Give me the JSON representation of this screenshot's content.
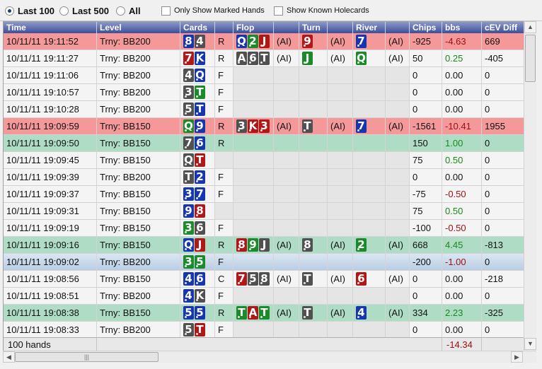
{
  "toolbar": {
    "last100_label": "Last 100",
    "last500_label": "Last 500",
    "all_label": "All",
    "selected_range": "Last 100",
    "only_marked_label": "Only Show Marked Hands",
    "show_known_label": "Show Known Holecards"
  },
  "columns": [
    "Time",
    "Level",
    "Cards",
    "",
    "Flop",
    "",
    "Turn",
    "",
    "River",
    "",
    "Chips",
    "bbs",
    "cEV Diff"
  ],
  "rows": [
    {
      "time": "10/11/11 19:11:52",
      "level": "Trny: BB200",
      "hole": [
        [
          "8",
          "d"
        ],
        [
          "4",
          "s"
        ]
      ],
      "action": "R",
      "flop": [
        [
          "Q",
          "d"
        ],
        [
          "2",
          "c"
        ],
        [
          "J",
          "h"
        ]
      ],
      "flop_ai": "(AI)",
      "turn": [
        [
          "9",
          "h"
        ]
      ],
      "turn_ai": "(AI)",
      "river": [
        [
          "7",
          "d"
        ]
      ],
      "river_ai": "(AI)",
      "chips": "-925",
      "bbs": "-4.63",
      "cev": "669",
      "highlight": "red",
      "sel": false
    },
    {
      "time": "10/11/11 19:11:27",
      "level": "Trny: BB200",
      "hole": [
        [
          "7",
          "h"
        ],
        [
          "K",
          "d"
        ]
      ],
      "action": "R",
      "flop": [
        [
          "A",
          "s"
        ],
        [
          "6",
          "s"
        ],
        [
          "T",
          "s"
        ]
      ],
      "flop_ai": "(AI)",
      "turn": [
        [
          "J",
          "c"
        ]
      ],
      "turn_ai": "(AI)",
      "river": [
        [
          "Q",
          "c"
        ]
      ],
      "river_ai": "(AI)",
      "chips": "50",
      "bbs": "0.25",
      "cev": "-405",
      "highlight": "",
      "sel": false
    },
    {
      "time": "10/11/11 19:11:06",
      "level": "Trny: BB200",
      "hole": [
        [
          "4",
          "s"
        ],
        [
          "Q",
          "d"
        ]
      ],
      "action": "F",
      "flop": [],
      "flop_ai": "",
      "turn": [],
      "turn_ai": "",
      "river": [],
      "river_ai": "",
      "chips": "0",
      "bbs": "0.00",
      "cev": "0",
      "highlight": "",
      "sel": false
    },
    {
      "time": "10/11/11 19:10:57",
      "level": "Trny: BB200",
      "hole": [
        [
          "3",
          "s"
        ],
        [
          "T",
          "c"
        ]
      ],
      "action": "F",
      "flop": [],
      "flop_ai": "",
      "turn": [],
      "turn_ai": "",
      "river": [],
      "river_ai": "",
      "chips": "0",
      "bbs": "0.00",
      "cev": "0",
      "highlight": "",
      "sel": false
    },
    {
      "time": "10/11/11 19:10:28",
      "level": "Trny: BB200",
      "hole": [
        [
          "5",
          "s"
        ],
        [
          "T",
          "d"
        ]
      ],
      "action": "F",
      "flop": [],
      "flop_ai": "",
      "turn": [],
      "turn_ai": "",
      "river": [],
      "river_ai": "",
      "chips": "0",
      "bbs": "0.00",
      "cev": "0",
      "highlight": "",
      "sel": false
    },
    {
      "time": "10/11/11 19:09:59",
      "level": "Trny: BB150",
      "hole": [
        [
          "Q",
          "c"
        ],
        [
          "9",
          "d"
        ]
      ],
      "action": "R",
      "flop": [
        [
          "3",
          "s"
        ],
        [
          "K",
          "h"
        ],
        [
          "3",
          "h"
        ]
      ],
      "flop_ai": "(AI)",
      "turn": [
        [
          "T",
          "s"
        ]
      ],
      "turn_ai": "(AI)",
      "river": [
        [
          "7",
          "d"
        ]
      ],
      "river_ai": "(AI)",
      "chips": "-1561",
      "bbs": "-10.41",
      "cev": "1955",
      "highlight": "red",
      "sel": false
    },
    {
      "time": "10/11/11 19:09:50",
      "level": "Trny: BB150",
      "hole": [
        [
          "7",
          "s"
        ],
        [
          "6",
          "d"
        ]
      ],
      "action": "R",
      "flop": [],
      "flop_ai": "",
      "turn": [],
      "turn_ai": "",
      "river": [],
      "river_ai": "",
      "chips": "150",
      "bbs": "1.00",
      "cev": "0",
      "highlight": "green",
      "sel": false
    },
    {
      "time": "10/11/11 19:09:45",
      "level": "Trny: BB150",
      "hole": [
        [
          "Q",
          "s"
        ],
        [
          "T",
          "h"
        ]
      ],
      "action": "",
      "flop": [],
      "flop_ai": "",
      "turn": [],
      "turn_ai": "",
      "river": [],
      "river_ai": "",
      "chips": "75",
      "bbs": "0.50",
      "cev": "0",
      "highlight": "",
      "sel": false
    },
    {
      "time": "10/11/11 19:09:39",
      "level": "Trny: BB200",
      "hole": [
        [
          "T",
          "s"
        ],
        [
          "2",
          "d"
        ]
      ],
      "action": "F",
      "flop": [],
      "flop_ai": "",
      "turn": [],
      "turn_ai": "",
      "river": [],
      "river_ai": "",
      "chips": "0",
      "bbs": "0.00",
      "cev": "0",
      "highlight": "",
      "sel": false
    },
    {
      "time": "10/11/11 19:09:37",
      "level": "Trny: BB150",
      "hole": [
        [
          "3",
          "d"
        ],
        [
          "7",
          "d"
        ]
      ],
      "action": "F",
      "flop": [],
      "flop_ai": "",
      "turn": [],
      "turn_ai": "",
      "river": [],
      "river_ai": "",
      "chips": "-75",
      "bbs": "-0.50",
      "cev": "0",
      "highlight": "",
      "sel": false
    },
    {
      "time": "10/11/11 19:09:31",
      "level": "Trny: BB150",
      "hole": [
        [
          "9",
          "d"
        ],
        [
          "8",
          "h"
        ]
      ],
      "action": "",
      "flop": [],
      "flop_ai": "",
      "turn": [],
      "turn_ai": "",
      "river": [],
      "river_ai": "",
      "chips": "75",
      "bbs": "0.50",
      "cev": "0",
      "highlight": "",
      "sel": false
    },
    {
      "time": "10/11/11 19:09:19",
      "level": "Trny: BB150",
      "hole": [
        [
          "3",
          "c"
        ],
        [
          "6",
          "s"
        ]
      ],
      "action": "F",
      "flop": [],
      "flop_ai": "",
      "turn": [],
      "turn_ai": "",
      "river": [],
      "river_ai": "",
      "chips": "-100",
      "bbs": "-0.50",
      "cev": "0",
      "highlight": "",
      "sel": false
    },
    {
      "time": "10/11/11 19:09:16",
      "level": "Trny: BB150",
      "hole": [
        [
          "Q",
          "d"
        ],
        [
          "J",
          "h"
        ]
      ],
      "action": "R",
      "flop": [
        [
          "8",
          "h"
        ],
        [
          "9",
          "c"
        ],
        [
          "J",
          "s"
        ]
      ],
      "flop_ai": "(AI)",
      "turn": [
        [
          "8",
          "s"
        ]
      ],
      "turn_ai": "(AI)",
      "river": [
        [
          "2",
          "c"
        ]
      ],
      "river_ai": "(AI)",
      "chips": "668",
      "bbs": "4.45",
      "cev": "-813",
      "highlight": "green",
      "sel": false
    },
    {
      "time": "10/11/11 19:09:02",
      "level": "Trny: BB200",
      "hole": [
        [
          "3",
          "c"
        ],
        [
          "5",
          "c"
        ]
      ],
      "action": "F",
      "flop": [],
      "flop_ai": "",
      "turn": [],
      "turn_ai": "",
      "river": [],
      "river_ai": "",
      "chips": "-200",
      "bbs": "-1.00",
      "cev": "0",
      "highlight": "",
      "sel": true
    },
    {
      "time": "10/11/11 19:08:56",
      "level": "Trny: BB150",
      "hole": [
        [
          "4",
          "d"
        ],
        [
          "6",
          "d"
        ]
      ],
      "action": "C",
      "flop": [
        [
          "7",
          "h"
        ],
        [
          "5",
          "s"
        ],
        [
          "8",
          "s"
        ]
      ],
      "flop_ai": "(AI)",
      "turn": [
        [
          "T",
          "s"
        ]
      ],
      "turn_ai": "(AI)",
      "river": [
        [
          "6",
          "h"
        ]
      ],
      "river_ai": "(AI)",
      "chips": "0",
      "bbs": "0.00",
      "cev": "-218",
      "highlight": "",
      "sel": false
    },
    {
      "time": "10/11/11 19:08:51",
      "level": "Trny: BB200",
      "hole": [
        [
          "4",
          "d"
        ],
        [
          "K",
          "s"
        ]
      ],
      "action": "F",
      "flop": [],
      "flop_ai": "",
      "turn": [],
      "turn_ai": "",
      "river": [],
      "river_ai": "",
      "chips": "0",
      "bbs": "0.00",
      "cev": "0",
      "highlight": "",
      "sel": false
    },
    {
      "time": "10/11/11 19:08:38",
      "level": "Trny: BB150",
      "hole": [
        [
          "5",
          "d"
        ],
        [
          "5",
          "d"
        ]
      ],
      "action": "R",
      "flop": [
        [
          "T",
          "c"
        ],
        [
          "A",
          "h"
        ],
        [
          "T",
          "c"
        ]
      ],
      "flop_ai": "(AI)",
      "turn": [
        [
          "T",
          "s"
        ]
      ],
      "turn_ai": "(AI)",
      "river": [
        [
          "4",
          "d"
        ]
      ],
      "river_ai": "(AI)",
      "chips": "334",
      "bbs": "2.23",
      "cev": "-325",
      "highlight": "green",
      "sel": false
    },
    {
      "time": "10/11/11 19:08:33",
      "level": "Trny: BB200",
      "hole": [
        [
          "5",
          "s"
        ],
        [
          "T",
          "h"
        ]
      ],
      "action": "F",
      "flop": [],
      "flop_ai": "",
      "turn": [],
      "turn_ai": "",
      "river": [],
      "river_ai": "",
      "chips": "0",
      "bbs": "0.00",
      "cev": "0",
      "highlight": "",
      "sel": false
    }
  ],
  "footer": {
    "hands_label": "100 hands",
    "bbs_total": "-14.34"
  },
  "colors": {
    "header_top": "#8a98c8",
    "header_bottom": "#3e4f98",
    "lose_row": "#f4989a",
    "win_row": "#aedcc4",
    "spade": "#505050",
    "heart": "#b01818",
    "diamond": "#1636b0",
    "club": "#1a8a2a"
  }
}
